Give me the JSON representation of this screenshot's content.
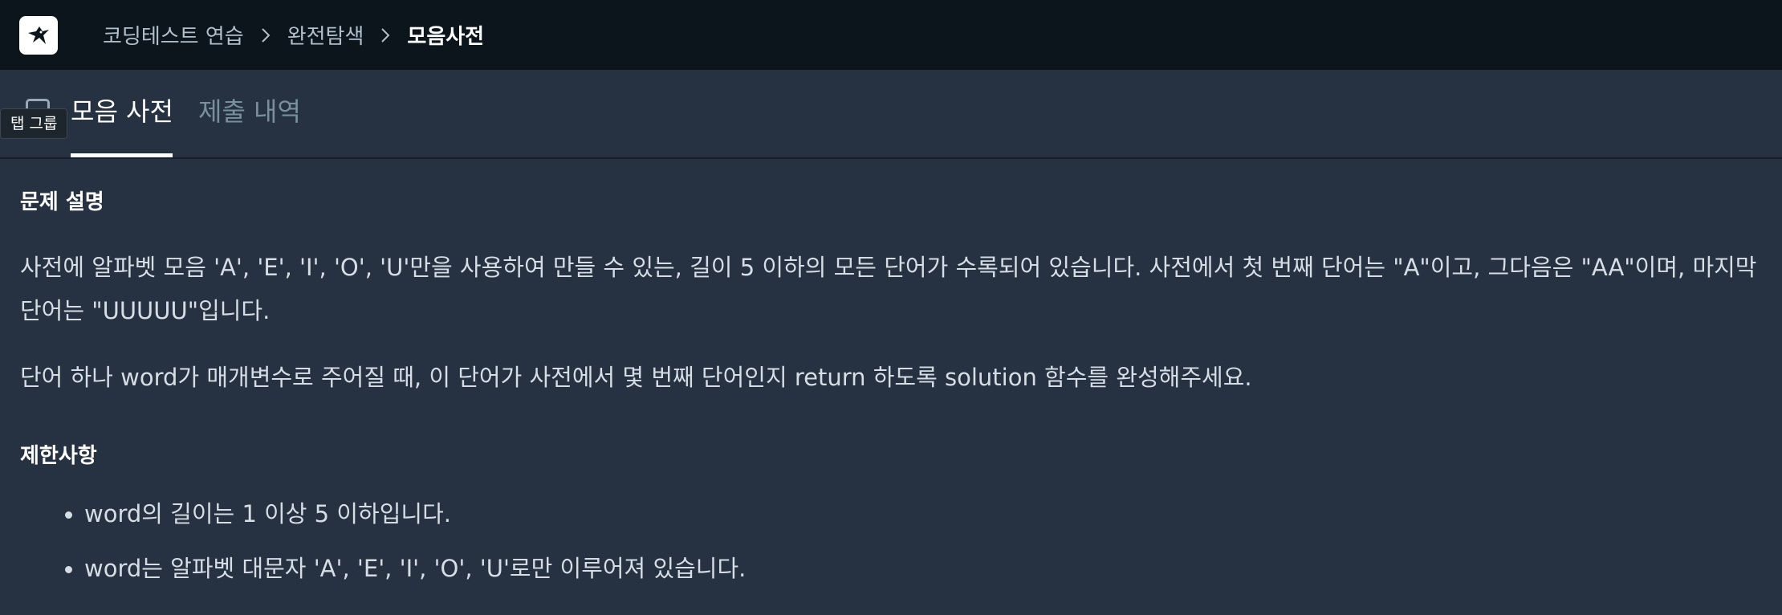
{
  "breadcrumb": {
    "items": [
      "코딩테스트 연습",
      "완전탐색"
    ],
    "current": "모음사전"
  },
  "tabs": {
    "tooltip": "탭 그룹",
    "active": "모음 사전",
    "inactive": "제출 내역"
  },
  "problem": {
    "description_heading": "문제 설명",
    "description_p1": "사전에 알파벳 모음 'A', 'E', 'I', 'O', 'U'만을 사용하여 만들 수 있는, 길이 5 이하의 모든 단어가 수록되어 있습니다. 사전에서 첫 번째 단어는 \"A\"이고, 그다음은 \"AA\"이며, 마지막 단어는 \"UUUUU\"입니다.",
    "description_p2": "단어 하나 word가 매개변수로 주어질 때, 이 단어가 사전에서 몇 번째 단어인지 return 하도록 solution 함수를 완성해주세요.",
    "constraints_heading": "제한사항",
    "constraints": [
      "word의 길이는 1 이상 5 이하입니다.",
      "word는 알파벳 대문자 'A', 'E', 'I', 'O', 'U'로만 이루어져 있습니다."
    ]
  },
  "icons": {
    "logo": "hummingbird-logo-icon",
    "separator": "chevron-right-icon",
    "tab_group": "tab-group-icon"
  },
  "colors": {
    "topbar_bg": "#0c151c",
    "page_bg": "#263241",
    "text": "#d6dde5",
    "inactive_tab": "#78909c"
  }
}
